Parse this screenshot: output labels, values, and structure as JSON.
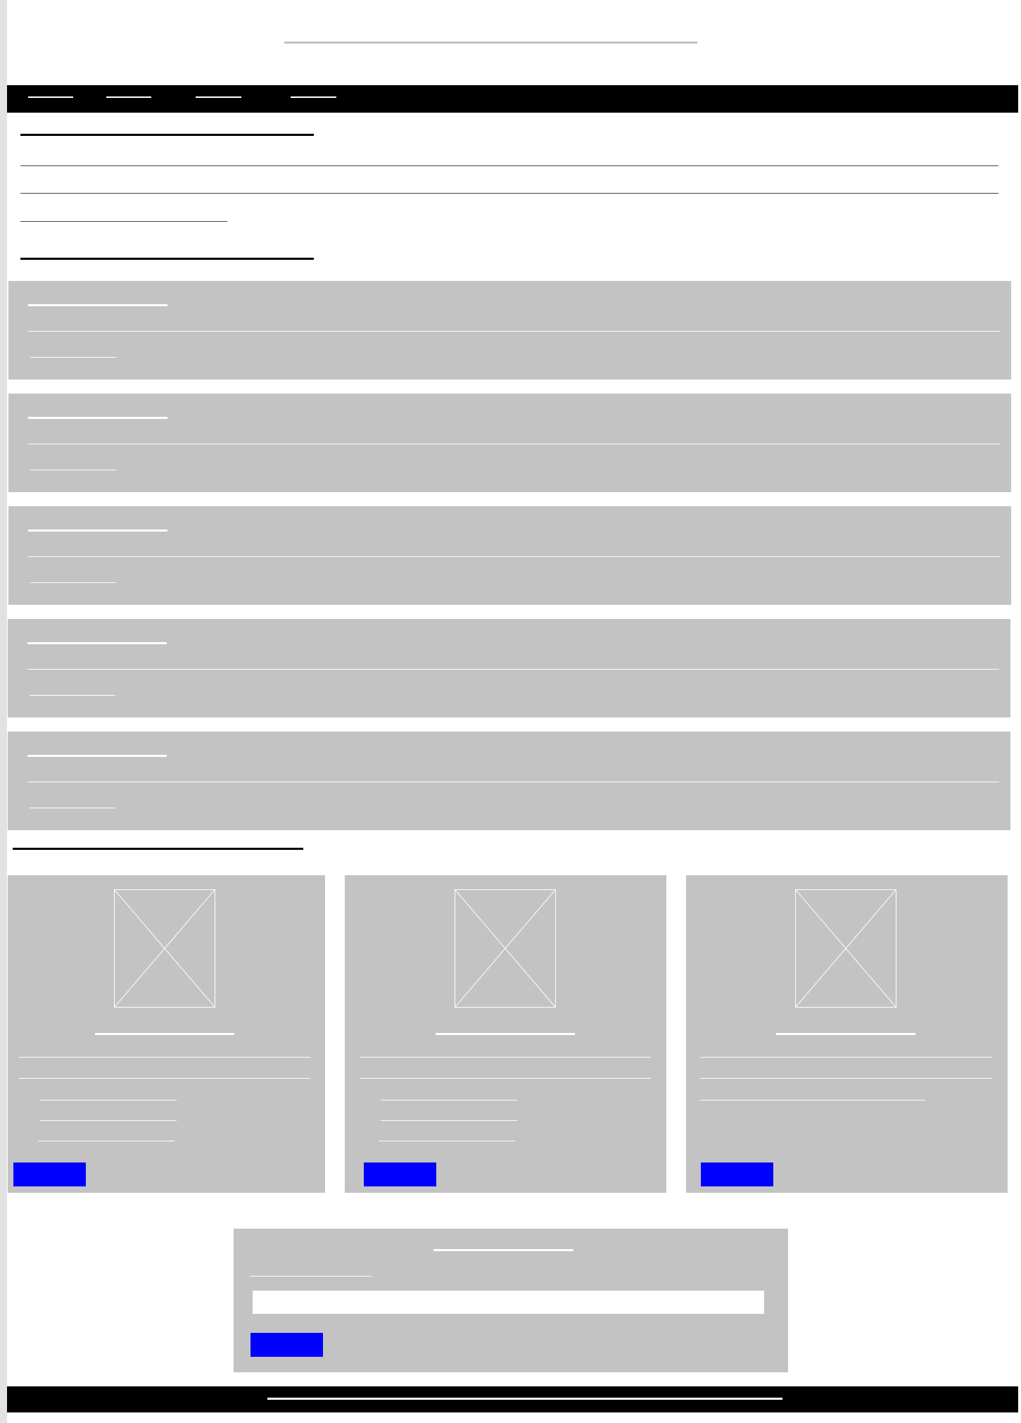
{
  "page": {
    "title": "",
    "colors": {
      "background": "#ffffff",
      "nav_background": "#000000",
      "panel_gray": "#c3c3c3",
      "placeholder_line": "#ffffff",
      "button_blue": "#0000ff",
      "footer_background": "#000000"
    }
  },
  "nav": {
    "items": [
      {
        "label": ""
      },
      {
        "label": ""
      },
      {
        "label": ""
      },
      {
        "label": ""
      }
    ]
  },
  "intro": {
    "heading": "",
    "paragraph": ""
  },
  "list_section": {
    "heading": "",
    "items": [
      {
        "title": "",
        "description": "",
        "link": ""
      },
      {
        "title": "",
        "description": "",
        "link": ""
      },
      {
        "title": "",
        "description": "",
        "link": ""
      },
      {
        "title": "",
        "description": "",
        "link": ""
      },
      {
        "title": "",
        "description": "",
        "link": ""
      }
    ]
  },
  "products_section": {
    "heading": "",
    "products": [
      {
        "image_icon": "image-placeholder-icon",
        "title": "",
        "description": "",
        "features": [
          "",
          "",
          ""
        ],
        "button_label": ""
      },
      {
        "image_icon": "image-placeholder-icon",
        "title": "",
        "description": "",
        "features": [
          "",
          "",
          ""
        ],
        "button_label": ""
      },
      {
        "image_icon": "image-placeholder-icon",
        "title": "",
        "description": "",
        "features": [],
        "button_label": ""
      }
    ]
  },
  "form": {
    "title": "",
    "label": "",
    "input_value": "",
    "input_placeholder": "",
    "submit_label": ""
  },
  "footer": {
    "text": ""
  }
}
